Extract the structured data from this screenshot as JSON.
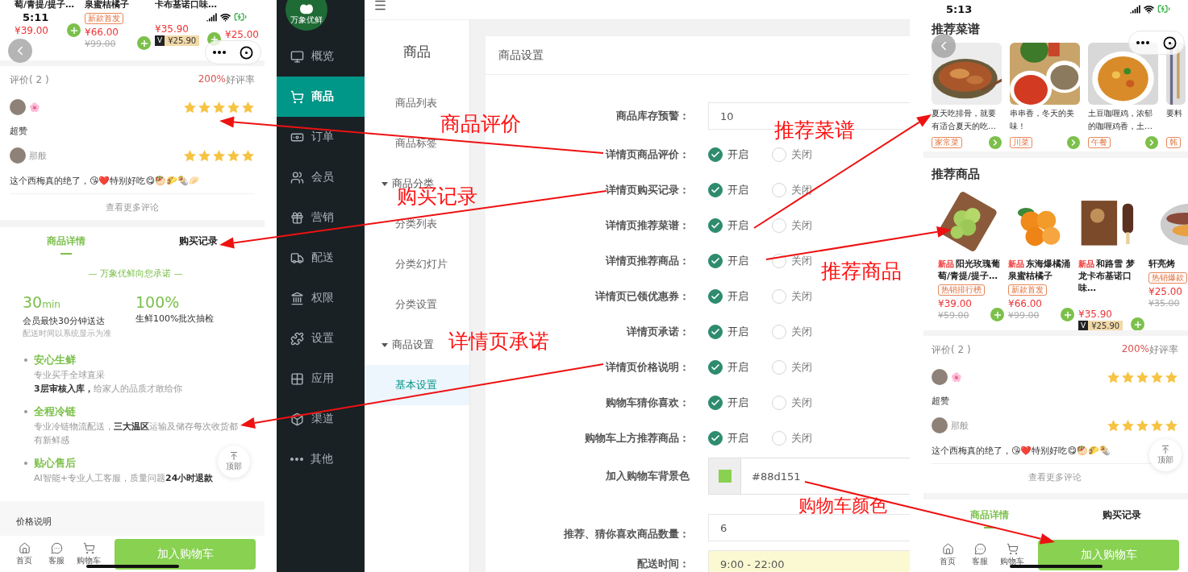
{
  "left_phone": {
    "status_time": "5:11",
    "products": [
      {
        "name": "萄/青提/提子…",
        "price": "¥39.00"
      },
      {
        "name": "泉蜜桔橘子",
        "tag": "新款首发",
        "price": "¥66.00",
        "original_price": "¥99.00"
      },
      {
        "name": "卡布基诺口味…",
        "price": "¥35.90",
        "member_mark": "V",
        "member_price": "¥25.90"
      },
      {
        "price": "¥25.00"
      }
    ],
    "reviews": {
      "title": "评价( 2 )",
      "rate_value": "200%",
      "rate_label": "好评率",
      "items": [
        {
          "name": "🌸",
          "stars": 5,
          "comment": "超赞"
        },
        {
          "name": "那般",
          "stars": 5,
          "comment": "这个西梅真的绝了，😘❤️特别好吃😋🥙🌮🌯🥟"
        }
      ],
      "more": "查看更多评论"
    },
    "detail_tabs": [
      {
        "label": "商品详情",
        "selected": true
      },
      {
        "label": "购买记录",
        "selected": false
      }
    ],
    "promise": {
      "heading": "— 万象优鲜向您承诺 —",
      "stats": [
        {
          "value": "30",
          "unit": "min",
          "desc": "会员最快30分钟送达",
          "note": "配送时间以系统显示为准"
        },
        {
          "value": "100%",
          "desc": "生鲜100%批次抽检"
        }
      ],
      "points": [
        {
          "title": "安心生鲜",
          "lines": [
            "专业买手全球直采",
            "**3层审核入库，**给家人的品质才敢给你"
          ]
        },
        {
          "title": "全程冷链",
          "lines": [
            "专业冷链物流配送，**三大温区**运输及储存每次收货都有新鲜感"
          ]
        },
        {
          "title": "贴心售后",
          "lines": [
            "AI智能+专业人工客服，质量问题**24小时退款**"
          ]
        }
      ]
    },
    "back_to_top": "顶部",
    "price_note": "价格说明",
    "bottom_bar": {
      "nav": [
        "首页",
        "客服",
        "购物车"
      ],
      "button": "加入购物车"
    }
  },
  "admin": {
    "logo_text": "万象优鲜",
    "nav": [
      {
        "label": "概览",
        "selected": false
      },
      {
        "label": "商品",
        "selected": true
      },
      {
        "label": "订单",
        "selected": false
      },
      {
        "label": "会员",
        "selected": false
      },
      {
        "label": "营销",
        "selected": false
      },
      {
        "label": "配送",
        "selected": false
      },
      {
        "label": "权限",
        "selected": false
      },
      {
        "label": "设置",
        "selected": false
      },
      {
        "label": "应用",
        "selected": false
      },
      {
        "label": "渠道",
        "selected": false
      },
      {
        "label": "其他",
        "selected": false
      }
    ],
    "subnav": {
      "title": "商品",
      "items": [
        {
          "kind": "link",
          "label": "商品列表",
          "selected": false
        },
        {
          "kind": "link",
          "label": "商品标签",
          "selected": false
        },
        {
          "kind": "group",
          "label": "商品分类",
          "expanded": true,
          "children": [
            {
              "label": "分类列表",
              "selected": false
            },
            {
              "label": "分类幻灯片",
              "selected": false
            },
            {
              "label": "分类设置",
              "selected": false
            }
          ]
        },
        {
          "kind": "group",
          "label": "商品设置",
          "expanded": true,
          "children": [
            {
              "label": "基本设置",
              "selected": true
            }
          ]
        }
      ]
    },
    "panel": {
      "title": "商品设置",
      "fields": [
        {
          "kind": "input",
          "label": "商品库存预警：",
          "value": "10",
          "highlighted": false
        },
        {
          "kind": "radio",
          "label": "详情页商品评价：",
          "on": true,
          "on_label": "开启",
          "off_label": "关闭"
        },
        {
          "kind": "radio",
          "label": "详情页购买记录：",
          "on": true,
          "on_label": "开启",
          "off_label": "关闭"
        },
        {
          "kind": "radio",
          "label": "详情页推荐菜谱：",
          "on": true,
          "on_label": "开启",
          "off_label": "关闭"
        },
        {
          "kind": "radio",
          "label": "详情页推荐商品：",
          "on": true,
          "on_label": "开启",
          "off_label": "关闭"
        },
        {
          "kind": "radio",
          "label": "详情页已领优惠券：",
          "on": true,
          "on_label": "开启",
          "off_label": "关闭"
        },
        {
          "kind": "radio",
          "label": "详情页承诺：",
          "on": true,
          "on_label": "开启",
          "off_label": "关闭"
        },
        {
          "kind": "radio",
          "label": "详情页价格说明：",
          "on": true,
          "on_label": "开启",
          "off_label": "关闭"
        },
        {
          "kind": "radio",
          "label": "购物车猜你喜欢：",
          "on": true,
          "on_label": "开启",
          "off_label": "关闭"
        },
        {
          "kind": "radio",
          "label": "购物车上方推荐商品：",
          "on": true,
          "on_label": "开启",
          "off_label": "关闭"
        },
        {
          "kind": "color",
          "label": "加入购物车背景色",
          "value": "#88d151"
        },
        {
          "kind": "input",
          "label": "推荐、猜你喜欢商品数量：",
          "value": "6",
          "highlighted": false
        },
        {
          "kind": "input",
          "label": "配送时间：",
          "value": "9:00 - 22:00",
          "highlighted": true
        }
      ]
    }
  },
  "right_phone": {
    "status_time": "5:13",
    "recipes": {
      "title": "推荐菜谱",
      "items": [
        {
          "title": "夏天吃排骨，就要有适合夏天的吃…",
          "tag": "家常菜",
          "cut": false
        },
        {
          "title": "串串香，冬天的美味！",
          "tag": "川菜",
          "cut": false
        },
        {
          "title": "土豆咖喱鸡，浓郁的咖喱鸡香，土…",
          "tag": "午餐",
          "cut": false
        },
        {
          "title": "要料",
          "tag": "韩",
          "cut": true
        }
      ]
    },
    "products": {
      "title": "推荐商品",
      "items": [
        {
          "badge": "新品",
          "name": "阳光玫瑰葡萄/青提/提子…",
          "tag": "热销排行榜",
          "price": "¥39.00",
          "original_price": "¥59.00"
        },
        {
          "badge": "新品",
          "name": "东海爆橘涌泉蜜桔橘子",
          "tag": "新款首发",
          "price": "¥66.00",
          "original_price": "¥99.00"
        },
        {
          "badge": "新品",
          "name": "和路雪 梦龙卡布基诺口味…",
          "price": "¥35.90",
          "member_mark": "V",
          "member_price": "¥25.90"
        },
        {
          "name": "轩亮烤",
          "tag": "热销爆款",
          "price": "¥25.00",
          "original_price": "¥35.00"
        }
      ]
    },
    "reviews": {
      "title": "评价( 2 )",
      "rate_value": "200%",
      "rate_label": "好评率",
      "items": [
        {
          "name": "🌸",
          "stars": 5,
          "comment": "超赞"
        },
        {
          "name": "那般",
          "stars": 5,
          "comment": "这个西梅真的绝了，😘❤️特别好吃😋🥙🌮🌯"
        }
      ],
      "more": "查看更多评论"
    },
    "detail_tabs": [
      {
        "label": "商品详情",
        "selected": true
      },
      {
        "label": "购买记录",
        "selected": false
      }
    ],
    "back_to_top": "顶部",
    "bottom_bar": {
      "nav": [
        "首页",
        "客服",
        "购物车"
      ],
      "button": "加入购物车"
    }
  },
  "annotations": [
    "商品评价",
    "购买记录",
    "详情页承诺",
    "推荐菜谱",
    "推荐商品",
    "购物车颜色"
  ]
}
